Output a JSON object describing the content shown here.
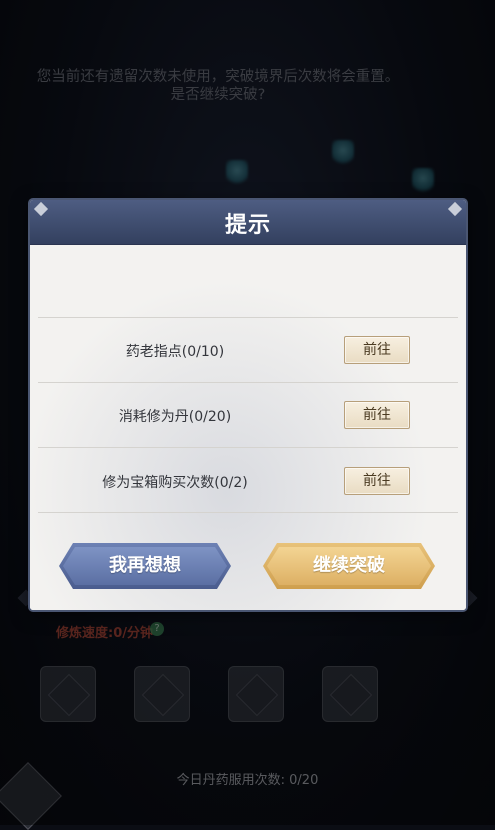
{
  "dialog": {
    "title": "提示",
    "message_line1": "您当前还有遗留次数未使用，突破境界后次数将会重置。",
    "message_line2": "是否继续突破?",
    "tasks": [
      {
        "label": "药老指点(0/10)",
        "button": "前往"
      },
      {
        "label": "消耗修为丹(0/20)",
        "button": "前往"
      },
      {
        "label": "修为宝箱购买次数(0/2)",
        "button": "前往"
      }
    ],
    "cancel_label": "我再想想",
    "confirm_label": "继续突破"
  },
  "background": {
    "speed_label": "修炼速度:0/分钟",
    "daily_usage": "今日丹药服用次数: 0/20"
  },
  "colors": {
    "header": "#3f4c6e",
    "cancel_button": "#5b6fa3",
    "confirm_button": "#ddb064",
    "go_button": "#ede2cc"
  }
}
